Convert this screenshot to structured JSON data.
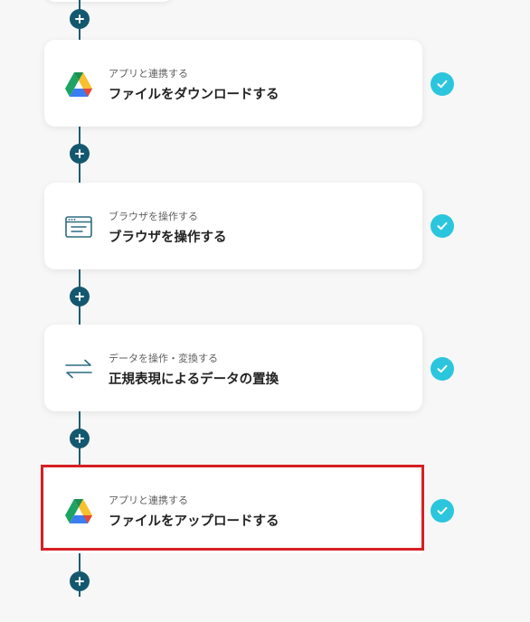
{
  "flow": {
    "steps": [
      {
        "category": "アプリと連携する",
        "title": "ファイルをダウンロードする",
        "icon": "google-drive-icon",
        "status": "completed",
        "highlighted": false
      },
      {
        "category": "ブラウザを操作する",
        "title": "ブラウザを操作する",
        "icon": "browser-window-icon",
        "status": "completed",
        "highlighted": false
      },
      {
        "category": "データを操作・変換する",
        "title": "正規表現によるデータの置換",
        "icon": "swap-arrows-icon",
        "status": "completed",
        "highlighted": false
      },
      {
        "category": "アプリと連携する",
        "title": "ファイルをアップロードする",
        "icon": "google-drive-icon",
        "status": "completed",
        "highlighted": true
      }
    ]
  },
  "colors": {
    "background": "#f7f7f7",
    "connector": "#1f5b72",
    "add_button": "#14586f",
    "check": "#2bc6dd",
    "highlight_border": "#d62024",
    "icon_teal": "#2c6b82"
  }
}
